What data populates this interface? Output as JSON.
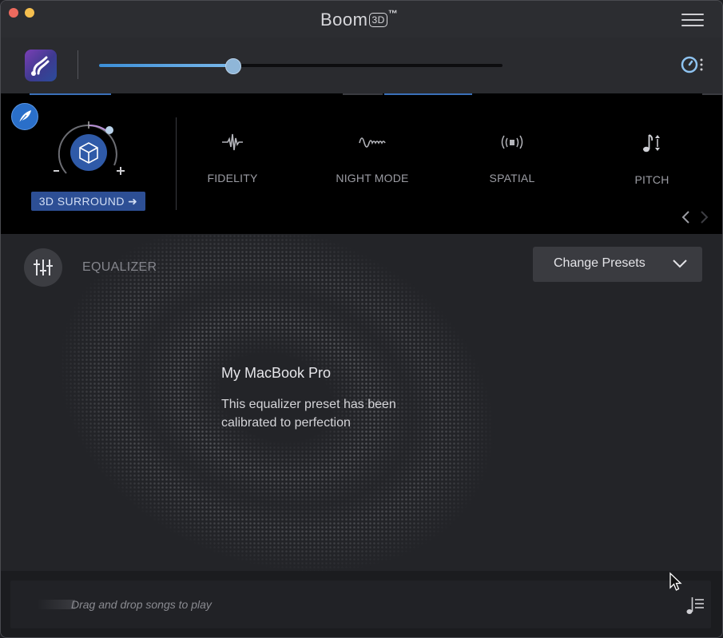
{
  "window": {
    "title": "Boom",
    "title_badge": "3D",
    "title_tm": "™"
  },
  "volume": {
    "level": 0.33
  },
  "effects": {
    "surround_button": "3D SURROUND ➜",
    "items": [
      {
        "label": "FIDELITY",
        "icon": "waveform-pulse-icon"
      },
      {
        "label": "NIGHT MODE",
        "icon": "waveform-compressed-icon"
      },
      {
        "label": "SPATIAL",
        "icon": "spatial-speaker-icon"
      },
      {
        "label": "PITCH",
        "icon": "music-note-pitch-icon"
      }
    ]
  },
  "equalizer": {
    "label": "EQUALIZER",
    "presets_button": "Change Presets",
    "preset_name": "My MacBook Pro",
    "preset_description": "This equalizer preset has been calibrated to perfection"
  },
  "dropbar": {
    "text": "Drag and drop songs to play"
  },
  "colors": {
    "accent": "#2d4f95",
    "slider": "#7ab8ea",
    "background": "#232428"
  }
}
